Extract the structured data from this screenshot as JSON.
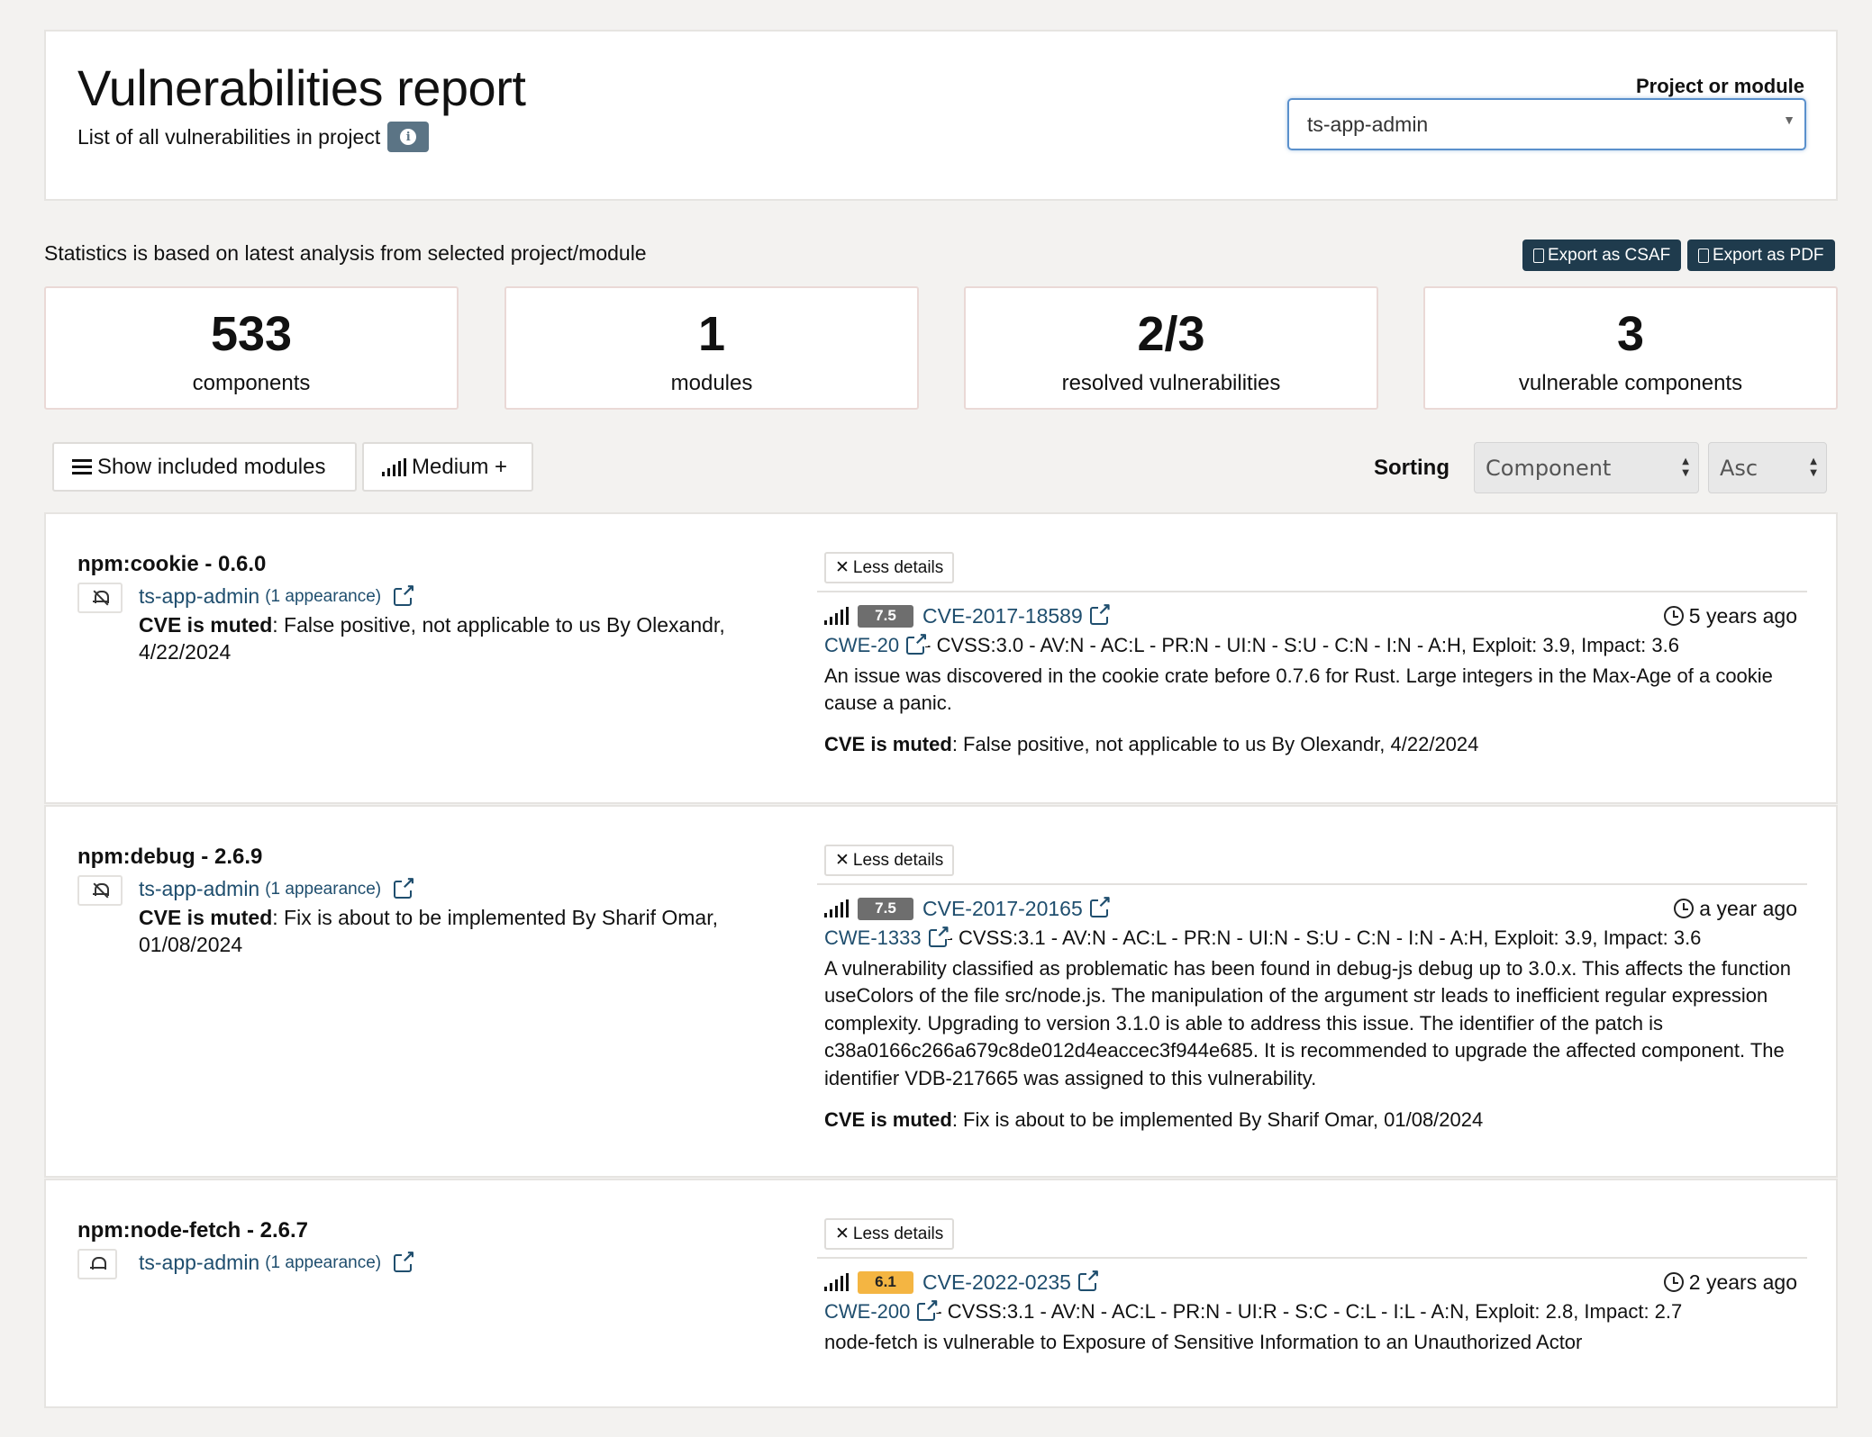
{
  "header": {
    "title": "Vulnerabilities report",
    "subtitle": "List of all vulnerabilities in project",
    "info_icon": "info-icon",
    "project_label": "Project or module",
    "project_value": "ts-app-admin"
  },
  "stats_note": "Statistics is based on latest analysis from selected project/module",
  "export": {
    "csaf_label": "Export as CSAF",
    "pdf_label": "Export as PDF"
  },
  "stats": [
    {
      "value": "533",
      "label": "components"
    },
    {
      "value": "1",
      "label": "modules"
    },
    {
      "value": "2/3",
      "label": "resolved vulnerabilities"
    },
    {
      "value": "3",
      "label": "vulnerable components"
    }
  ],
  "toolbar": {
    "show_modules_label": "Show included modules",
    "severity_label": "Medium +",
    "sorting_label": "Sorting",
    "sort_field": "Component",
    "sort_order": "Asc"
  },
  "vulnerabilities": [
    {
      "component": "npm:cookie - 0.6.0",
      "project": "ts-app-admin",
      "appearance": "(1 appearance)",
      "muted": true,
      "muted_label": "CVE is muted",
      "left_muted_text": ": False positive, not applicable to us By Olexandr, 4/22/2024",
      "less_details": "Less details",
      "score": "7.5",
      "score_color": "#6e6e6e",
      "cve_id": "CVE-2017-18589",
      "age": "5 years ago",
      "cwe": "CWE-20",
      "cvss": " - CVSS:3.0 - AV:N - AC:L - PR:N - UI:N - S:U - C:N - I:N - A:H, Exploit: 3.9, Impact: 3.6",
      "description": "An issue was discovered in the cookie crate before 0.7.6 for Rust. Large integers in the Max-Age of a cookie cause a panic.",
      "right_muted_text": ": False positive, not applicable to us By Olexandr, 4/22/2024"
    },
    {
      "component": "npm:debug - 2.6.9",
      "project": "ts-app-admin",
      "appearance": "(1 appearance)",
      "muted": true,
      "muted_label": "CVE is muted",
      "left_muted_text": ": Fix is about to be implemented By Sharif Omar, 01/08/2024",
      "less_details": "Less details",
      "score": "7.5",
      "score_color": "#6e6e6e",
      "cve_id": "CVE-2017-20165",
      "age": "a year ago",
      "cwe": "CWE-1333",
      "cvss": " - CVSS:3.1 - AV:N - AC:L - PR:N - UI:N - S:U - C:N - I:N - A:H, Exploit: 3.9, Impact: 3.6",
      "description": "A vulnerability classified as problematic has been found in debug-js debug up to 3.0.x. This affects the function useColors of the file src/node.js. The manipulation of the argument str leads to inefficient regular expression complexity. Upgrading to version 3.1.0 is able to address this issue. The identifier of the patch is c38a0166c266a679c8de012d4eaccec3f944e685. It is recommended to upgrade the affected component. The identifier VDB-217665 was assigned to this vulnerability.",
      "right_muted_text": ": Fix is about to be implemented By Sharif Omar, 01/08/2024"
    },
    {
      "component": "npm:node-fetch - 2.6.7",
      "project": "ts-app-admin",
      "appearance": "(1 appearance)",
      "muted": false,
      "less_details": "Less details",
      "score": "6.1",
      "score_color": "#f4b542",
      "cve_id": "CVE-2022-0235",
      "age": "2 years ago",
      "cwe": "CWE-200",
      "cvss": " - CVSS:3.1 - AV:N - AC:L - PR:N - UI:R - S:C - C:L - I:L - A:N, Exploit: 2.8, Impact: 2.7",
      "description": "node-fetch is vulnerable to Exposure of Sensitive Information to an Unauthorized Actor"
    }
  ]
}
